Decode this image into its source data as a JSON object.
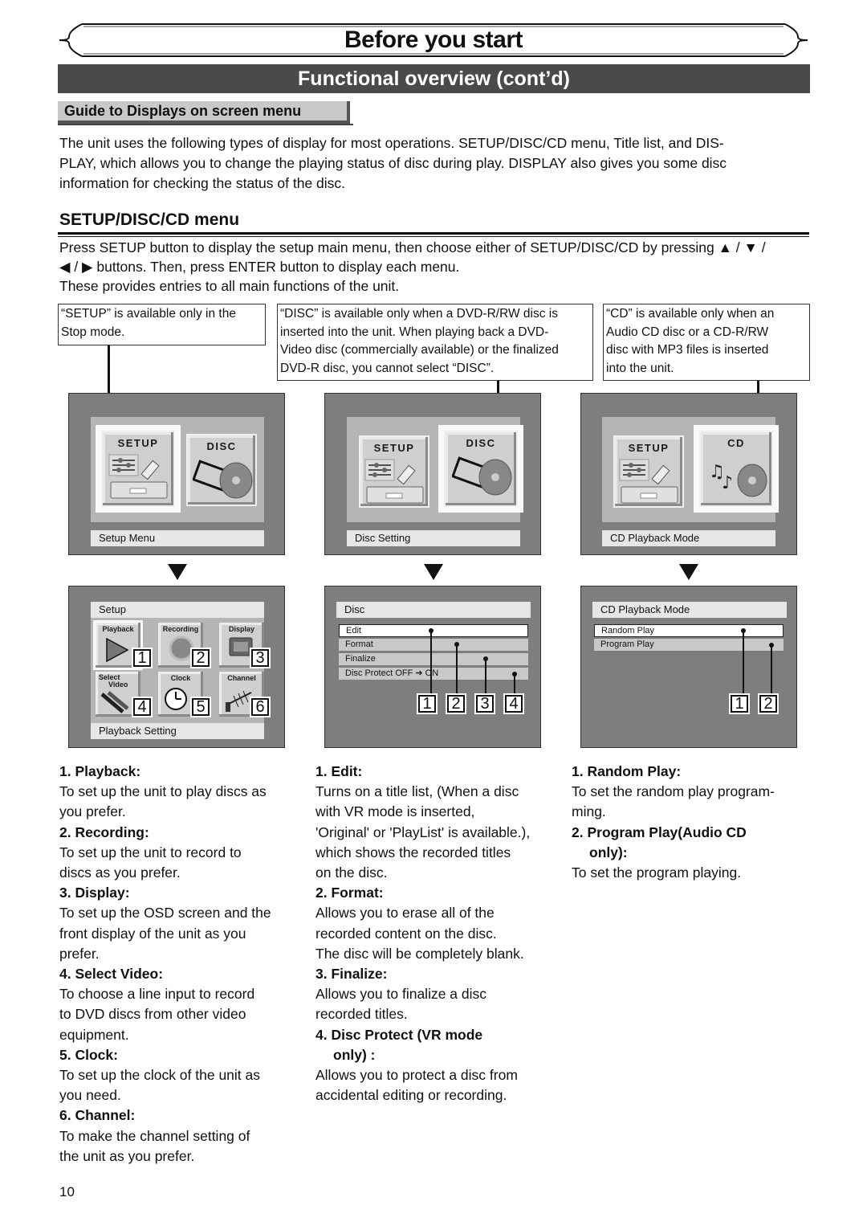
{
  "banner": {
    "title": "Before you start"
  },
  "section": {
    "title": "Functional overview (cont’d)"
  },
  "guide_tab": {
    "label": "Guide to Displays on screen menu"
  },
  "intro": {
    "lines": [
      "The unit uses the following types of display for most operations. SETUP/DISC/CD menu, Title list, and DIS-",
      "PLAY, which allows you to change the playing status of disc during play. DISPLAY also gives you some disc",
      "information for checking the status of the disc."
    ]
  },
  "setup_section": {
    "heading": "SETUP/DISC/CD menu",
    "instructions": [
      "Press SETUP button to display the setup main menu, then choose either of SETUP/DISC/CD by pressing ▲ / ▼ /",
      "◀ / ▶ buttons. Then, press ENTER button to display each menu.",
      "These provides entries to all main functions of the unit."
    ]
  },
  "notes": {
    "setup": [
      "“SETUP” is available only in the",
      "Stop mode."
    ],
    "disc": [
      "“DISC” is available only when a DVD-R/RW disc is",
      "inserted into the unit.  When playing back a DVD-",
      "Video disc (commercially available) or the finalized",
      "DVD-R disc, you cannot select “DISC”."
    ],
    "cd": [
      "“CD” is available only when an",
      "Audio CD disc or a CD-R/RW",
      "disc with MP3 files is inserted",
      "into the unit."
    ]
  },
  "top_screens": [
    {
      "left_tile": "SETUP",
      "right_tile": "DISC",
      "selected": "SETUP",
      "status": "Setup Menu"
    },
    {
      "left_tile": "SETUP",
      "right_tile": "DISC",
      "selected": "DISC",
      "status": "Disc Setting"
    },
    {
      "left_tile": "SETUP",
      "right_tile": "CD",
      "selected": "CD",
      "status": "CD Playback Mode"
    }
  ],
  "setup_screen": {
    "header": "Setup",
    "tiles": [
      {
        "label": "Playback",
        "number": "1"
      },
      {
        "label": "Recording",
        "number": "2"
      },
      {
        "label": "Display",
        "number": "3"
      },
      {
        "label": "Select\nVideo",
        "label_line1": "Select",
        "label_line2": "Video",
        "number": "4"
      },
      {
        "label": "Clock",
        "number": "5"
      },
      {
        "label": "Channel",
        "number": "6"
      }
    ],
    "status": "Playback Setting"
  },
  "disc_screen": {
    "header": "Disc",
    "items": [
      {
        "label": "Edit",
        "number": "1",
        "selected": true
      },
      {
        "label": "Format",
        "number": "2"
      },
      {
        "label": "Finalize",
        "number": "3"
      },
      {
        "label": "Disc Protect OFF ➔ ON",
        "number": "4"
      }
    ]
  },
  "cd_screen": {
    "header": "CD Playback Mode",
    "items": [
      {
        "label": "Random Play",
        "number": "1",
        "selected": true
      },
      {
        "label": "Program Play",
        "number": "2"
      }
    ]
  },
  "descriptions": {
    "setup": [
      {
        "heading": "1. Playback:",
        "text": [
          "To set up the unit to play discs as",
          "you prefer."
        ]
      },
      {
        "heading": "2. Recording:",
        "text": [
          "To set up the unit to record to",
          "discs as you prefer."
        ]
      },
      {
        "heading": "3. Display:",
        "text": [
          "To set up the OSD screen and the",
          "front display of the unit as you",
          "prefer."
        ]
      },
      {
        "heading": "4. Select Video:",
        "text": [
          "To choose a line input to record",
          "to DVD discs from other video",
          "equipment."
        ]
      },
      {
        "heading": "5. Clock:",
        "text": [
          "To set up the clock of the unit as",
          "you need."
        ]
      },
      {
        "heading": "6. Channel:",
        "text": [
          "To make the channel setting of",
          "the unit as you prefer."
        ]
      }
    ],
    "disc": [
      {
        "heading": "1. Edit:",
        "text": [
          "Turns on a title list, (When a disc",
          "with VR mode is inserted,",
          "'Original' or 'PlayList' is available.),",
          "which shows the recorded titles",
          "on the disc."
        ]
      },
      {
        "heading": "2. Format:",
        "text": [
          "Allows you to erase all of the",
          "recorded content on the disc.",
          "The disc will be completely blank."
        ]
      },
      {
        "heading": "3. Finalize:",
        "text": [
          "Allows you to finalize a disc",
          "recorded titles."
        ]
      },
      {
        "heading": "4. Disc Protect (VR mode",
        "heading2": "only) :",
        "text": [
          "Allows you to protect a disc from",
          "accidental editing or recording."
        ]
      }
    ],
    "cd": [
      {
        "heading": "1. Random Play:",
        "text": [
          "To set the random play program-",
          "ming."
        ]
      },
      {
        "heading": "2. Program Play(Audio CD",
        "heading2": "only):",
        "text": [
          "To set the program playing."
        ]
      }
    ]
  },
  "page_number": "10",
  "colors": {
    "section_bar": "#4a4a4a",
    "screen_bg": "#7e7e7e",
    "screen_inner": "#b5b5b5",
    "tab_bg": "#c8c8c8"
  }
}
